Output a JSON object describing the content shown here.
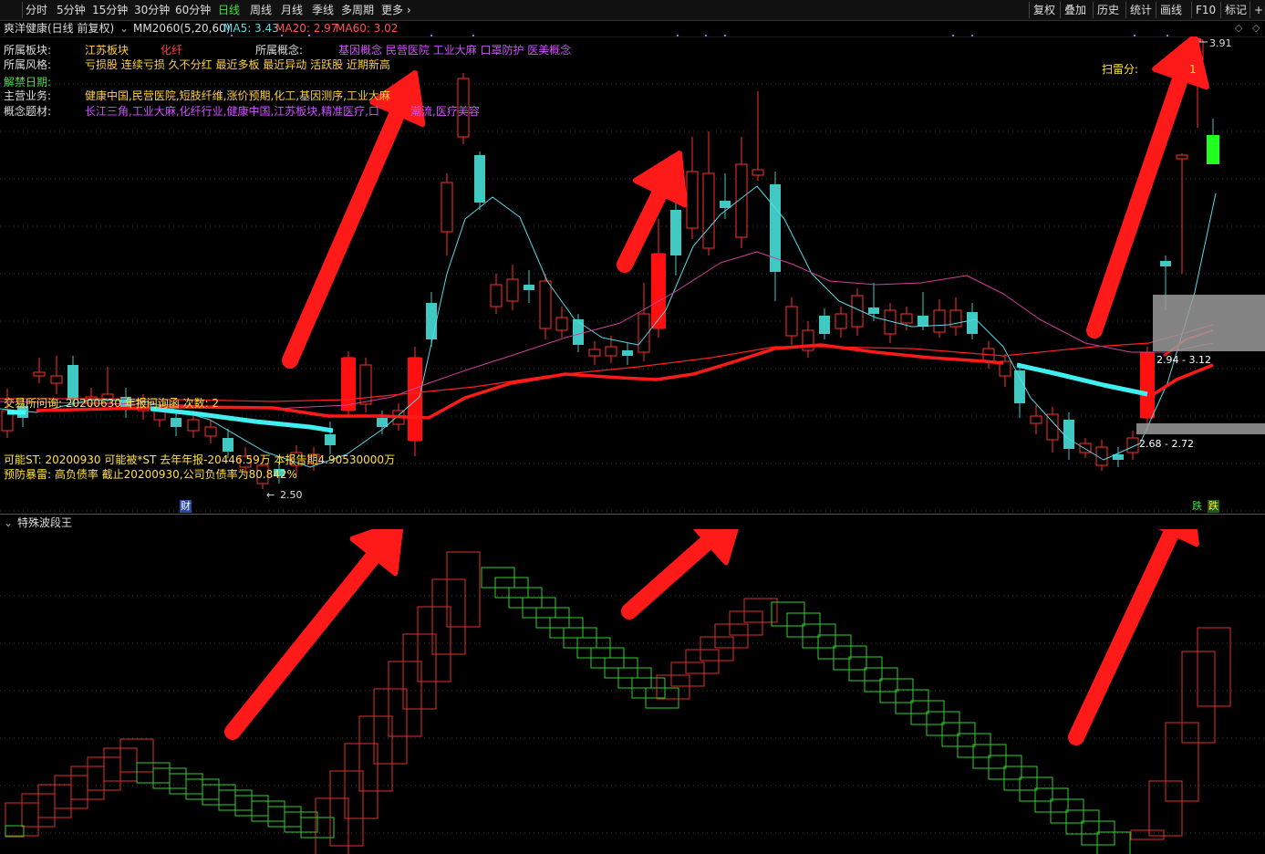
{
  "toolbar": {
    "left_tabs": [
      "分时",
      "5分钟",
      "15分钟",
      "30分钟",
      "60分钟",
      "日线",
      "周线",
      "月线",
      "季线",
      "多周期",
      "更多"
    ],
    "active_tab": "日线",
    "right_tabs": [
      "复权",
      "叠加",
      "历史",
      "统计",
      "画线",
      "F10",
      "标记",
      "+自"
    ],
    "close_symbol": "✕"
  },
  "stock": {
    "title": "爽洋健康(日线 前复权)",
    "indicator": "MM2060(5,20,60)",
    "ma5": "MA5: 3.43",
    "ma20": "MA20: 2.97",
    "ma60": "MA60: 3.02"
  },
  "info": {
    "sector_label": "所属板块:",
    "sector_value": "江苏板块",
    "sector_value2": "化纤",
    "concept_label": "所属概念:",
    "concept_value": "基因概念 民营医院 工业大麻 口罩防护 医美概念",
    "style_label": "所属风格:",
    "style_value": "亏损股 连续亏损 久不分红 最近多板 最近异动 活跃股 近期新高",
    "unlock_label": "解禁日期:",
    "business_label": "主营业务:",
    "business_value": "健康中国,民营医院,短肢纤维,涨价预期,化工,基因测序,工业大麻",
    "theme_label": "概念题材:",
    "theme_value": "长江三角,工业大麻,化纤行业,健康中国,江苏板块,精准医疗,口",
    "theme_value_tail": "潮流,医疗美容",
    "scan_label": "扫雷分:",
    "scan_value": "1"
  },
  "alerts": {
    "inquiry": "交易所问询: 20200630 年报问询函  次数: 2",
    "st": "可能ST: 20200930 可能被*ST 去年年报-20446.59万 本报告期4.90530000万",
    "mine": "预防暴雷: 高负债率 截止20200930,公司负债率为80.842%"
  },
  "price_labels": {
    "high": "3.91",
    "low": "2.50",
    "zone_upper": "2.94 - 3.12",
    "zone_lower": "2.68 - 2.72"
  },
  "markers": {
    "finance": "财",
    "fall1": "跌",
    "fall2": "跌"
  },
  "subchart": {
    "title": "特殊波段王"
  },
  "colors": {
    "up": "#ff3030",
    "down": "#3fc9c2",
    "ma5": "#5ad8e6",
    "ma20": "#d0409a",
    "ma60": "#ff2020",
    "arrow": "#ff1a1a",
    "sub_up": "#e03030",
    "sub_down": "#30d030",
    "purple": "#d050ff",
    "yellow": "#ffe040"
  },
  "chart_data": {
    "type": "candlestick",
    "title": "",
    "series": [
      {
        "name": "MA5",
        "values": []
      },
      {
        "name": "MA20",
        "values": []
      },
      {
        "name": "MA60",
        "values": []
      }
    ]
  }
}
